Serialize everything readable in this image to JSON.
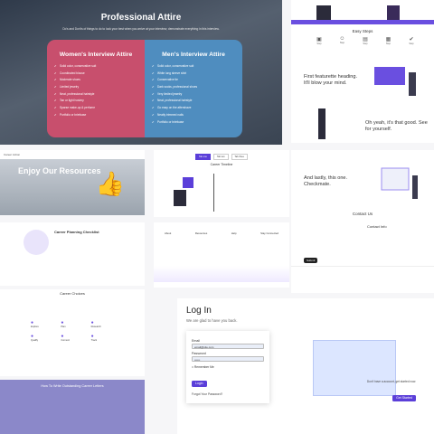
{
  "attire": {
    "title": "Professional Attire",
    "subtitle": "Do's and Don'ts of things to do to look your best when you arrive at your interview, demonstrate everything in this interview.",
    "women": {
      "heading": "Women's Interview Attire",
      "items": [
        "Solid color, conservative suit",
        "Coordinated blouse",
        "Moderate shoes",
        "Limited jewelry",
        "Neat, professional hairstyle",
        "Tan or light hosiery",
        "Sparse make-up & perfume",
        "Portfolio or briefcase"
      ]
    },
    "men": {
      "heading": "Men's Interview Attire",
      "items": [
        "Solid color, conservative suit",
        "White long sleeve shirt",
        "Conservative tie",
        "Dark socks, professional shoes",
        "Very limited jewelry",
        "Neat, professional hairstyle",
        "Go easy on the aftershave",
        "Neatly trimmed nails",
        "Portfolio or briefcase"
      ]
    }
  },
  "steps": {
    "title": "Easy Steps",
    "items": [
      {
        "icon": "briefcase-icon",
        "glyph": "▣",
        "label": "Step"
      },
      {
        "icon": "person-icon",
        "glyph": "☺",
        "label": "Step"
      },
      {
        "icon": "document-icon",
        "glyph": "▤",
        "label": "Step"
      },
      {
        "icon": "chart-icon",
        "glyph": "▦",
        "label": "Step"
      },
      {
        "icon": "check-circle-icon",
        "glyph": "✔",
        "label": "Step"
      }
    ],
    "heading_first": "First featurette heading. It'll blow your mind.",
    "heading_oh": "Oh yeah, it's that good. See for yourself."
  },
  "resources": {
    "topbar": "Career Action",
    "title": "Enjoy Our Resources"
  },
  "timeline": {
    "tabs": [
      "Tab one",
      "Tab two",
      "Tab three"
    ],
    "title": "Career Timeline"
  },
  "checkmarks": {
    "heading": "And lastly, this one. Checkmate.",
    "contact_title": "Contact Us",
    "info_title": "Contact Info",
    "button": "Submit"
  },
  "planning": {
    "title": "Career Planning Checklist"
  },
  "footer": {
    "cols": [
      "About",
      "Resources",
      "Help",
      "Stay Connected"
    ]
  },
  "choices": {
    "title": "Career Choices",
    "items": [
      "Explore",
      "Plan",
      "Research",
      "Qualify",
      "Connect",
      "Track"
    ]
  },
  "follow": {
    "title": "How To Write Outstanding Career Letters"
  },
  "login": {
    "title": "Log In",
    "subtitle": "We are glad to have you back.",
    "email_label": "Email",
    "email_value": "email@site.com",
    "password_label": "Password",
    "password_value": "••••••",
    "remember_label": "Remember Me",
    "button": "Login",
    "forgot": "Forgot Your Password?",
    "no_account": "Don't have a account, get started now.",
    "get_started": "Get Started"
  }
}
